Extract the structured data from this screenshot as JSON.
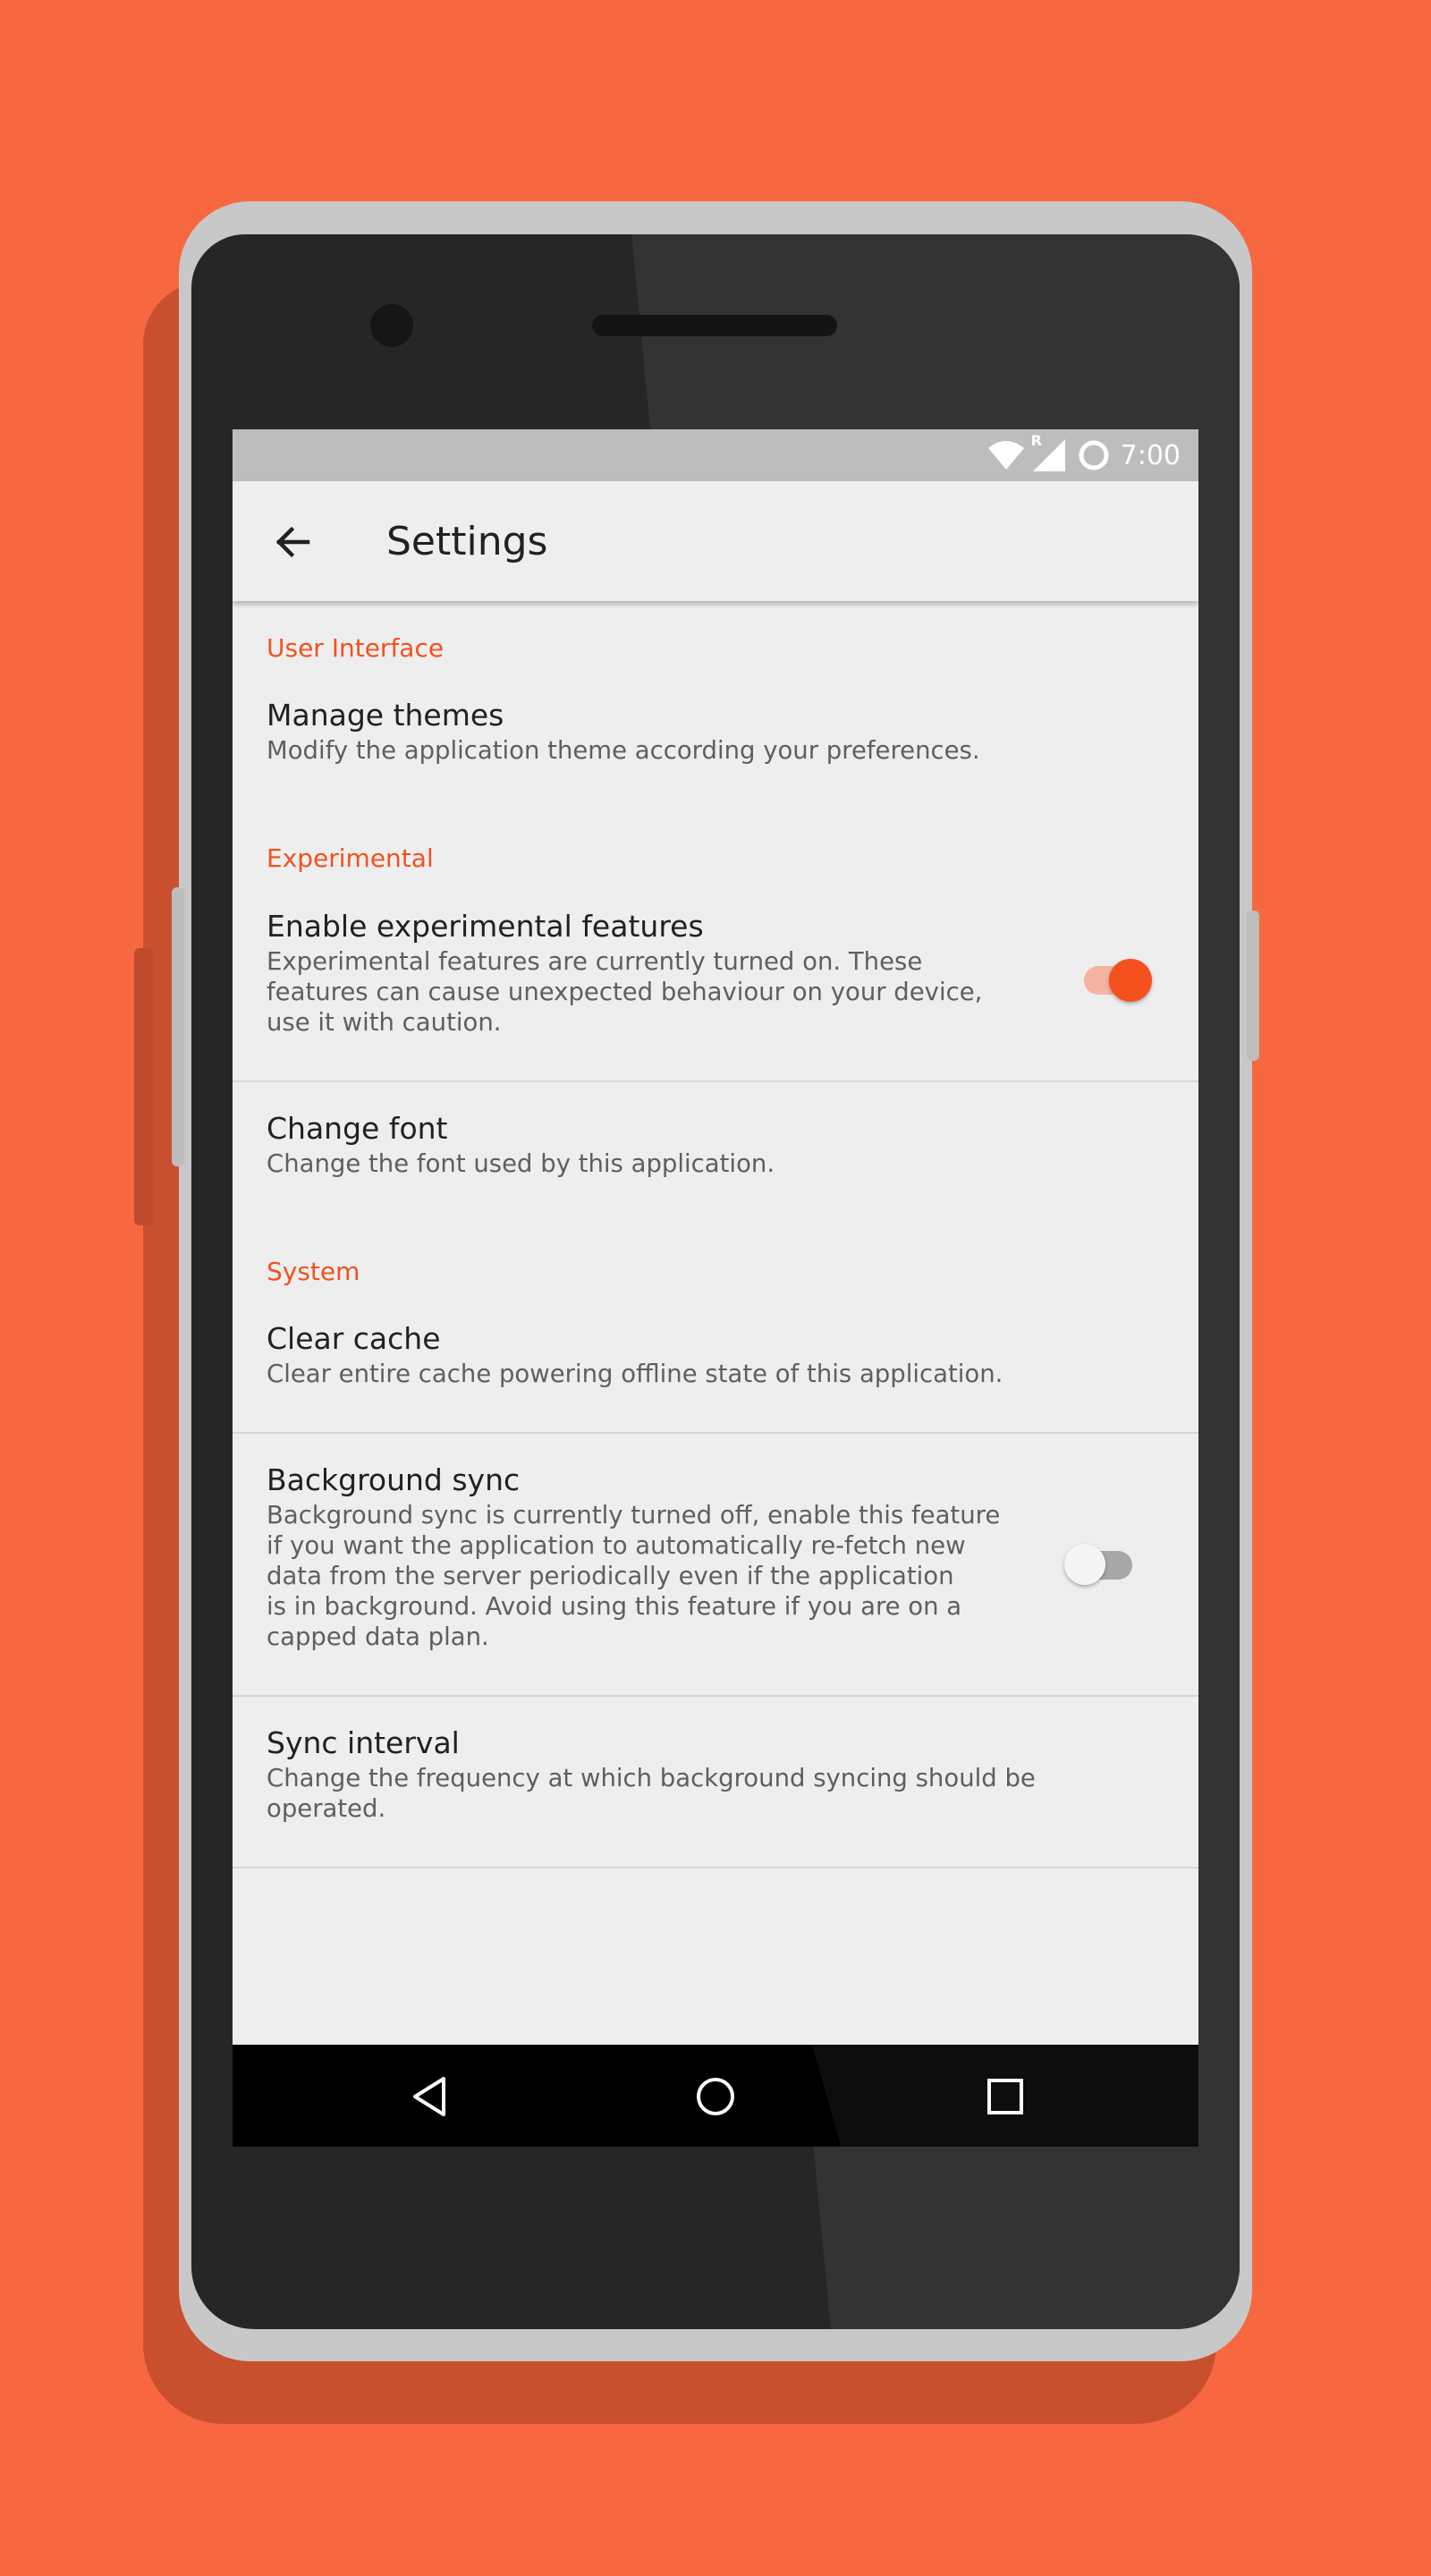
{
  "colors": {
    "background": "#F76841",
    "accent": "#F4511E",
    "screen": "#EEEEEE",
    "status_bar": "#BDBDBD"
  },
  "status_bar": {
    "time": "7:00",
    "roaming_label": "R",
    "icons": [
      "wifi-icon",
      "signal-icon",
      "battery-icon"
    ]
  },
  "app_bar": {
    "title": "Settings",
    "back_icon": "arrow-back-icon"
  },
  "sections": {
    "user_interface": {
      "header": "User Interface",
      "manage_themes": {
        "title": "Manage themes",
        "subtitle": "Modify the application theme according your preferences."
      }
    },
    "experimental": {
      "header": "Experimental",
      "enable_experimental": {
        "title": "Enable experimental features",
        "subtitle": "Experimental features are currently turned on. These\nfeatures can cause unexpected behaviour on your device,\nuse it with caution.",
        "switch_on": true
      },
      "change_font": {
        "title": "Change font",
        "subtitle": "Change the font used by this application."
      }
    },
    "system": {
      "header": "System",
      "clear_cache": {
        "title": "Clear cache",
        "subtitle": "Clear entire cache powering offline state of this application."
      },
      "background_sync": {
        "title": "Background sync",
        "subtitle": "Background sync is currently turned off, enable this feature\nif you want the application to automatically re-fetch new\ndata from the server periodically even if the application\nis in background. Avoid using this feature if you are on a\ncapped data plan.",
        "switch_on": false
      },
      "sync_interval": {
        "title": "Sync interval",
        "subtitle": "Change the frequency at which background syncing should be\noperated."
      }
    }
  },
  "nav_bar": {
    "icons": [
      "back-triangle-icon",
      "home-circle-icon",
      "recents-square-icon"
    ]
  }
}
